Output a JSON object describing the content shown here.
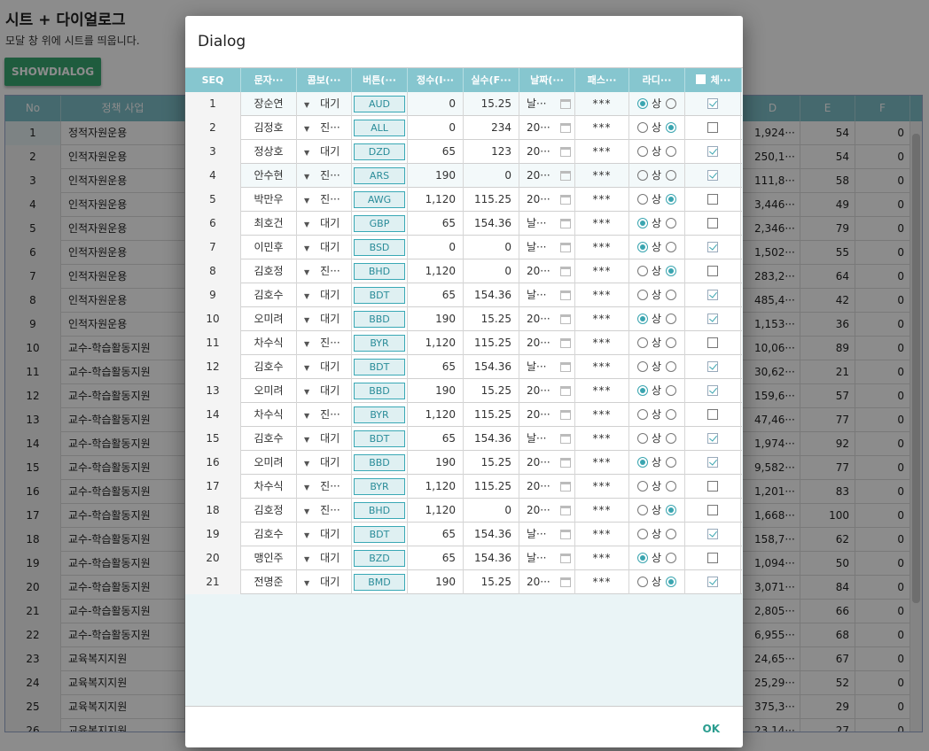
{
  "page": {
    "title": "시트 + 다이얼로그",
    "description": "모달 창 위에 시트를 띄웁니다.",
    "show_button": "SHOWDIALOG"
  },
  "bg_grid": {
    "headers": {
      "no": "No",
      "biz": "정책 사업",
      "d": "D",
      "e": "E",
      "f": "F"
    },
    "rows": [
      {
        "no": "1",
        "biz": "정적자원운용",
        "d": "1,924···",
        "e": "54",
        "f": "0"
      },
      {
        "no": "2",
        "biz": "인적자원운용",
        "d": "250,1···",
        "e": "54",
        "f": "0"
      },
      {
        "no": "3",
        "biz": "인적자원운용",
        "d": "111,8···",
        "e": "58",
        "f": "0"
      },
      {
        "no": "4",
        "biz": "인적자원운용",
        "d": "3,446···",
        "e": "49",
        "f": "0"
      },
      {
        "no": "5",
        "biz": "인적자원운용",
        "d": "2,346···",
        "e": "79",
        "f": "0"
      },
      {
        "no": "6",
        "biz": "인적자원운용",
        "d": "1,502···",
        "e": "55",
        "f": "0"
      },
      {
        "no": "7",
        "biz": "인적자원운용",
        "d": "283,2···",
        "e": "64",
        "f": "0"
      },
      {
        "no": "8",
        "biz": "인적자원운용",
        "d": "485,4···",
        "e": "42",
        "f": "0"
      },
      {
        "no": "9",
        "biz": "인적자원운용",
        "d": "1,153···",
        "e": "36",
        "f": "0"
      },
      {
        "no": "10",
        "biz": "교수-학습활동지원",
        "d": "10,06···",
        "e": "89",
        "f": "0"
      },
      {
        "no": "11",
        "biz": "교수-학습활동지원",
        "d": "30,62···",
        "e": "21",
        "f": "0"
      },
      {
        "no": "12",
        "biz": "교수-학습활동지원",
        "d": "159,6···",
        "e": "57",
        "f": "0"
      },
      {
        "no": "13",
        "biz": "교수-학습활동지원",
        "d": "47,46···",
        "e": "77",
        "f": "0"
      },
      {
        "no": "14",
        "biz": "교수-학습활동지원",
        "d": "1,974···",
        "e": "92",
        "f": "0"
      },
      {
        "no": "15",
        "biz": "교수-학습활동지원",
        "d": "9,582···",
        "e": "77",
        "f": "0"
      },
      {
        "no": "16",
        "biz": "교수-학습활동지원",
        "d": "1,201···",
        "e": "83",
        "f": "0"
      },
      {
        "no": "17",
        "biz": "교수-학습활동지원",
        "d": "1,668···",
        "e": "100",
        "f": "0"
      },
      {
        "no": "18",
        "biz": "교수-학습활동지원",
        "d": "158,7···",
        "e": "62",
        "f": "0"
      },
      {
        "no": "19",
        "biz": "교수-학습활동지원",
        "d": "1,094···",
        "e": "50",
        "f": "0"
      },
      {
        "no": "20",
        "biz": "교수-학습활동지원",
        "d": "3,071···",
        "e": "84",
        "f": "0"
      },
      {
        "no": "21",
        "biz": "교수-학습활동지원",
        "d": "2,805···",
        "e": "66",
        "f": "0"
      },
      {
        "no": "22",
        "biz": "교수-학습활동지원",
        "d": "6,955···",
        "e": "68",
        "f": "0"
      },
      {
        "no": "23",
        "biz": "교육복지지원",
        "d": "24,65···",
        "e": "67",
        "f": "0"
      },
      {
        "no": "24",
        "biz": "교육복지지원",
        "d": "25,29···",
        "e": "52",
        "f": "0"
      },
      {
        "no": "25",
        "biz": "교육복지지원",
        "d": "375,3···",
        "e": "29",
        "f": "0"
      },
      {
        "no": "26",
        "biz": "교육복지지원",
        "d": "23,14···",
        "e": "27",
        "f": "0"
      }
    ]
  },
  "dialog": {
    "title": "Dialog",
    "ok_label": "OK",
    "headers": {
      "seq": "SEQ",
      "txt": "문자···",
      "cmb": "콤보(···",
      "btn": "버튼(···",
      "int": "정수(I···",
      "real": "실수(F···",
      "date": "날짜(···",
      "pw": "패스···",
      "radio": "라디···",
      "chk": "체···"
    },
    "radio_label": "상",
    "rows": [
      {
        "seq": "1",
        "name": "장순연",
        "combo": "대기",
        "code": "AUD",
        "int": "0",
        "real": "15.25",
        "date": "날···",
        "pw": "***",
        "radio": 1,
        "check": true
      },
      {
        "seq": "2",
        "name": "김정호",
        "combo": "진···",
        "code": "ALL",
        "int": "0",
        "real": "234",
        "date": "20···",
        "pw": "***",
        "radio": 2,
        "check": false
      },
      {
        "seq": "3",
        "name": "정상호",
        "combo": "대기",
        "code": "DZD",
        "int": "65",
        "real": "123",
        "date": "20···",
        "pw": "***",
        "radio": 0,
        "check": true
      },
      {
        "seq": "4",
        "name": "안수현",
        "combo": "진···",
        "code": "ARS",
        "int": "190",
        "real": "0",
        "date": "20···",
        "pw": "***",
        "radio": 0,
        "check": true
      },
      {
        "seq": "5",
        "name": "박만우",
        "combo": "진···",
        "code": "AWG",
        "int": "1,120",
        "real": "115.25",
        "date": "20···",
        "pw": "***",
        "radio": 2,
        "check": false
      },
      {
        "seq": "6",
        "name": "최호건",
        "combo": "대기",
        "code": "GBP",
        "int": "65",
        "real": "154.36",
        "date": "날···",
        "pw": "***",
        "radio": 1,
        "check": false
      },
      {
        "seq": "7",
        "name": "이민후",
        "combo": "대기",
        "code": "BSD",
        "int": "0",
        "real": "0",
        "date": "날···",
        "pw": "***",
        "radio": 1,
        "check": true
      },
      {
        "seq": "8",
        "name": "김호정",
        "combo": "진···",
        "code": "BHD",
        "int": "1,120",
        "real": "0",
        "date": "20···",
        "pw": "***",
        "radio": 2,
        "check": false
      },
      {
        "seq": "9",
        "name": "김호수",
        "combo": "대기",
        "code": "BDT",
        "int": "65",
        "real": "154.36",
        "date": "날···",
        "pw": "***",
        "radio": 0,
        "check": true
      },
      {
        "seq": "10",
        "name": "오미려",
        "combo": "대기",
        "code": "BBD",
        "int": "190",
        "real": "15.25",
        "date": "20···",
        "pw": "***",
        "radio": 1,
        "check": true
      },
      {
        "seq": "11",
        "name": "차수식",
        "combo": "진···",
        "code": "BYR",
        "int": "1,120",
        "real": "115.25",
        "date": "20···",
        "pw": "***",
        "radio": 0,
        "check": false
      },
      {
        "seq": "12",
        "name": "김호수",
        "combo": "대기",
        "code": "BDT",
        "int": "65",
        "real": "154.36",
        "date": "날···",
        "pw": "***",
        "radio": 0,
        "check": true
      },
      {
        "seq": "13",
        "name": "오미려",
        "combo": "대기",
        "code": "BBD",
        "int": "190",
        "real": "15.25",
        "date": "20···",
        "pw": "***",
        "radio": 1,
        "check": true
      },
      {
        "seq": "14",
        "name": "차수식",
        "combo": "진···",
        "code": "BYR",
        "int": "1,120",
        "real": "115.25",
        "date": "20···",
        "pw": "***",
        "radio": 0,
        "check": false
      },
      {
        "seq": "15",
        "name": "김호수",
        "combo": "대기",
        "code": "BDT",
        "int": "65",
        "real": "154.36",
        "date": "날···",
        "pw": "***",
        "radio": 0,
        "check": true
      },
      {
        "seq": "16",
        "name": "오미려",
        "combo": "대기",
        "code": "BBD",
        "int": "190",
        "real": "15.25",
        "date": "20···",
        "pw": "***",
        "radio": 1,
        "check": true
      },
      {
        "seq": "17",
        "name": "차수식",
        "combo": "진···",
        "code": "BYR",
        "int": "1,120",
        "real": "115.25",
        "date": "20···",
        "pw": "***",
        "radio": 0,
        "check": false
      },
      {
        "seq": "18",
        "name": "김호정",
        "combo": "진···",
        "code": "BHD",
        "int": "1,120",
        "real": "0",
        "date": "20···",
        "pw": "***",
        "radio": 2,
        "check": false
      },
      {
        "seq": "19",
        "name": "김호수",
        "combo": "대기",
        "code": "BDT",
        "int": "65",
        "real": "154.36",
        "date": "날···",
        "pw": "***",
        "radio": 0,
        "check": true
      },
      {
        "seq": "20",
        "name": "맹인주",
        "combo": "대기",
        "code": "BZD",
        "int": "65",
        "real": "154.36",
        "date": "날···",
        "pw": "***",
        "radio": 1,
        "check": false
      },
      {
        "seq": "21",
        "name": "전명준",
        "combo": "대기",
        "code": "BMD",
        "int": "190",
        "real": "15.25",
        "date": "20···",
        "pw": "***",
        "radio": 2,
        "check": true
      }
    ]
  },
  "colors": {
    "header": "#86c6cf",
    "accent": "#3aa5b0",
    "show_button": "#3aa872"
  }
}
